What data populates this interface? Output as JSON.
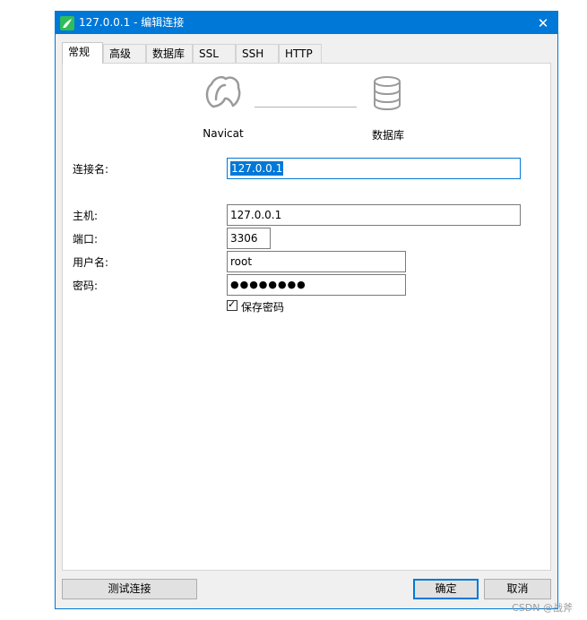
{
  "window": {
    "title": "127.0.0.1 - 编辑连接",
    "close_symbol": "✕",
    "accent_color": "#0078d7",
    "app_icon": "navicat-icon"
  },
  "tabs": [
    {
      "label": "常规",
      "active": true
    },
    {
      "label": "高级",
      "active": false
    },
    {
      "label": "数据库",
      "active": false
    },
    {
      "label": "SSL",
      "active": false
    },
    {
      "label": "SSH",
      "active": false
    },
    {
      "label": "HTTP",
      "active": false
    }
  ],
  "diagram": {
    "left_label": "Navicat",
    "left_icon": "navicat-logo-icon",
    "right_label": "数据库",
    "right_icon": "database-icon"
  },
  "form": {
    "connection_name": {
      "label": "连接名:",
      "value": "127.0.0.1"
    },
    "host": {
      "label": "主机:",
      "value": "127.0.0.1"
    },
    "port": {
      "label": "端口:",
      "value": "3306"
    },
    "username": {
      "label": "用户名:",
      "value": "root"
    },
    "password": {
      "label": "密码:",
      "value": "●●●●●●●●"
    },
    "save_password": {
      "label": "保存密码",
      "checked": true,
      "check_symbol": "✓"
    }
  },
  "buttons": {
    "test_connection": "测试连接",
    "ok": "确定",
    "cancel": "取消"
  },
  "watermark": "CSDN @战斧"
}
